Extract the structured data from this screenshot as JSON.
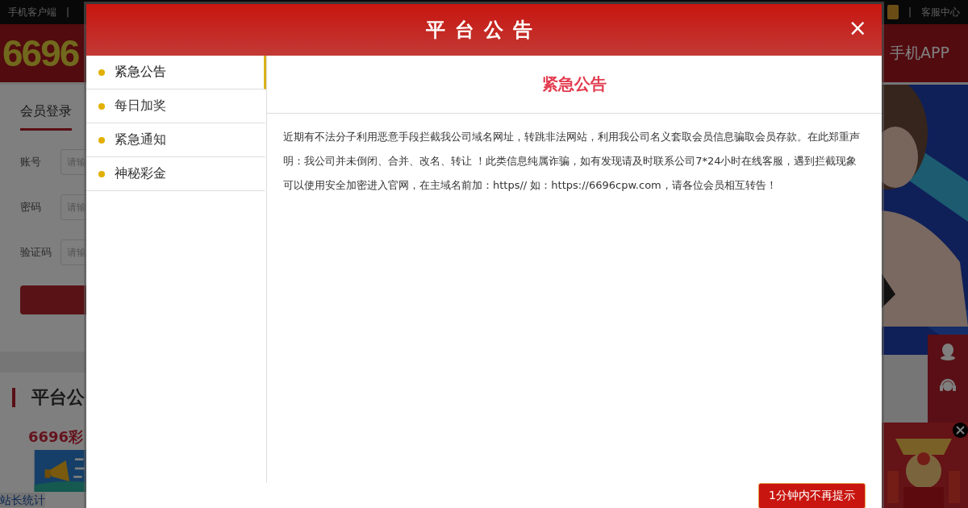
{
  "top_bar": {
    "left": [
      "手机客户端",
      "|"
    ],
    "right": [
      "|",
      "客服中心"
    ]
  },
  "header": {
    "logo": "6696",
    "nav": "手机APP"
  },
  "login": {
    "tab": "会员登录",
    "fields": [
      {
        "label": "账号",
        "placeholder": "请输"
      },
      {
        "label": "密码",
        "placeholder": "请输"
      },
      {
        "label": "验证码",
        "placeholder": "请输"
      }
    ]
  },
  "notice_section": {
    "title": "平台公",
    "subtitle": "6696彩"
  },
  "footer_link": "站长统计",
  "modal": {
    "title": "平台公告",
    "close": "×",
    "menu": [
      {
        "label": "紧急公告",
        "selected": true
      },
      {
        "label": "每日加奖",
        "selected": false
      },
      {
        "label": "紧急通知",
        "selected": false
      },
      {
        "label": "神秘彩金",
        "selected": false
      }
    ],
    "article": {
      "title": "紧急公告",
      "body": "近期有不法分子利用恶意手段拦截我公司域名网址，转跳非法网站，利用我公司名义套取会员信息骗取会员存款。在此郑重声明：我公司并未倒闭、合并、改名、转让 ！此类信息纯属诈骗，如有发现请及时联系公司7*24小时在线客服，遇到拦截现象可以使用安全加密进入官网，在主域名前加：https// 如：https://6696cpw.com，请各位会员相互转告！"
    },
    "dismiss_button": "1分钟内不再提示"
  }
}
